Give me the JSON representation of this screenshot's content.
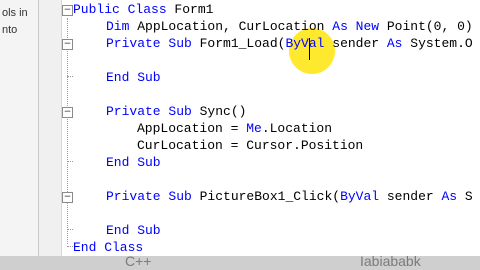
{
  "left_panel": {
    "lines": [
      "ols in",
      "nto"
    ]
  },
  "code": {
    "lines": [
      [
        {
          "t": "Public Class ",
          "k": true
        },
        {
          "t": "Form1"
        }
      ],
      [
        {
          "t": "Dim ",
          "k": true
        },
        {
          "t": "AppLocation, CurLocation "
        },
        {
          "t": "As New ",
          "k": true
        },
        {
          "t": "Point(0, 0)"
        }
      ],
      [
        {
          "t": "Private Sub ",
          "k": true
        },
        {
          "t": "Form1_Load("
        },
        {
          "t": "ByVal ",
          "k": true
        },
        {
          "t": "sender "
        },
        {
          "t": "As ",
          "k": true
        },
        {
          "t": "System.O"
        }
      ],
      [],
      [
        {
          "t": "End Sub",
          "k": true
        }
      ],
      [],
      [
        {
          "t": "Private Sub ",
          "k": true
        },
        {
          "t": "Sync()"
        }
      ],
      [
        {
          "t": "AppLocation = "
        },
        {
          "t": "Me",
          "k": true
        },
        {
          "t": ".Location"
        }
      ],
      [
        {
          "t": "CurLocation = Cursor.Position"
        }
      ],
      [
        {
          "t": "End Sub",
          "k": true
        }
      ],
      [],
      [
        {
          "t": "Private Sub ",
          "k": true
        },
        {
          "t": "PictureBox1_Click("
        },
        {
          "t": "ByVal ",
          "k": true
        },
        {
          "t": "sender "
        },
        {
          "t": "As ",
          "k": true
        },
        {
          "t": "S"
        }
      ],
      [],
      [
        {
          "t": "End Sub",
          "k": true
        }
      ],
      [
        {
          "t": "End Class",
          "k": true
        }
      ]
    ]
  },
  "fold_markers": [
    "−",
    "−",
    "−",
    "−"
  ],
  "bottom_bar": {
    "left_text": "C++",
    "right_text": "Iabiababk"
  },
  "colors": {
    "keyword": "#0000ff",
    "identifier": "#000000",
    "cursor_highlight": "#ffe400"
  }
}
